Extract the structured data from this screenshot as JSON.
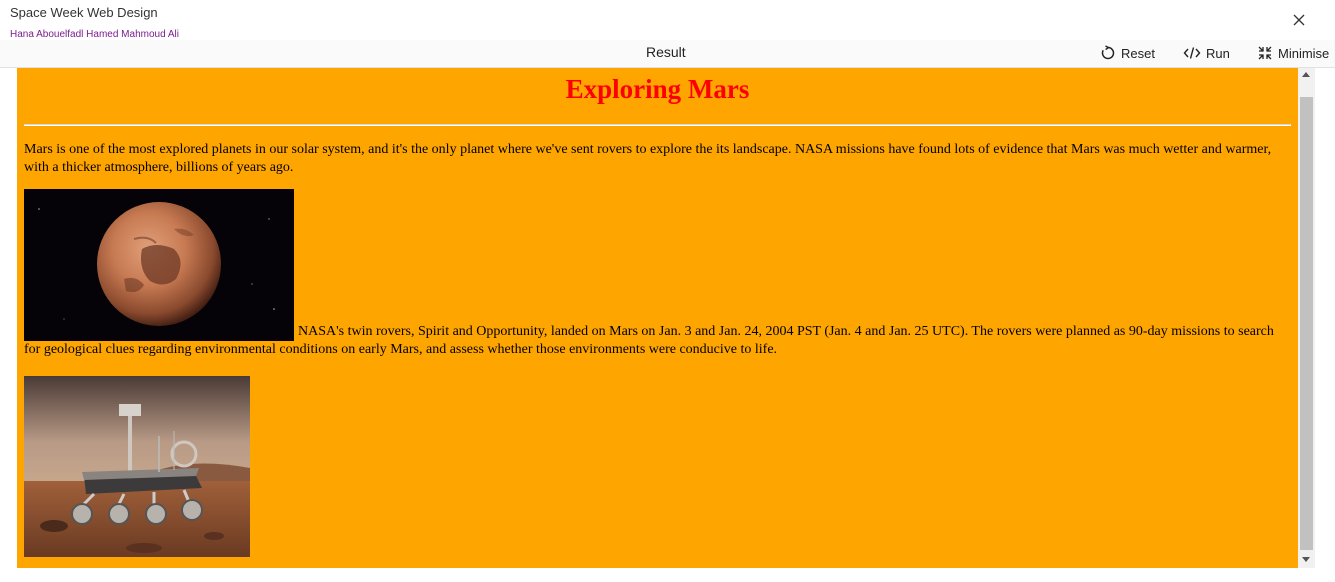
{
  "app": {
    "title": "Space Week Web Design",
    "author": "Hana Abouelfadl Hamed Mahmoud Ali"
  },
  "toolbar": {
    "result_label": "Result",
    "reset_label": "Reset",
    "run_label": "Run",
    "minimise_label": "Minimise"
  },
  "preview": {
    "heading": "Exploring Mars",
    "paragraph1": "Mars is one of the most explored planets in our solar system, and it's the only planet where we've sent rovers to explore the its landscape. NASA missions have found lots of evidence that Mars was much wetter and warmer, with a thicker atmosphere, billions of years ago.",
    "paragraph2": "NASA's twin rovers, Spirit and Opportunity, landed on Mars on Jan. 3 and Jan. 24, 2004 PST (Jan. 4 and Jan. 25 UTC). The rovers were planned as 90-day missions to search for geological clues regarding environmental conditions on early Mars, and assess whether those environments were conducive to life."
  },
  "colors": {
    "page_background": "#ffa500",
    "heading": "#ff0000",
    "author": "#7a1f8c"
  },
  "icons": {
    "close": "close-icon",
    "reset": "reset-icon",
    "run": "code-icon",
    "minimise": "minimise-icon"
  }
}
